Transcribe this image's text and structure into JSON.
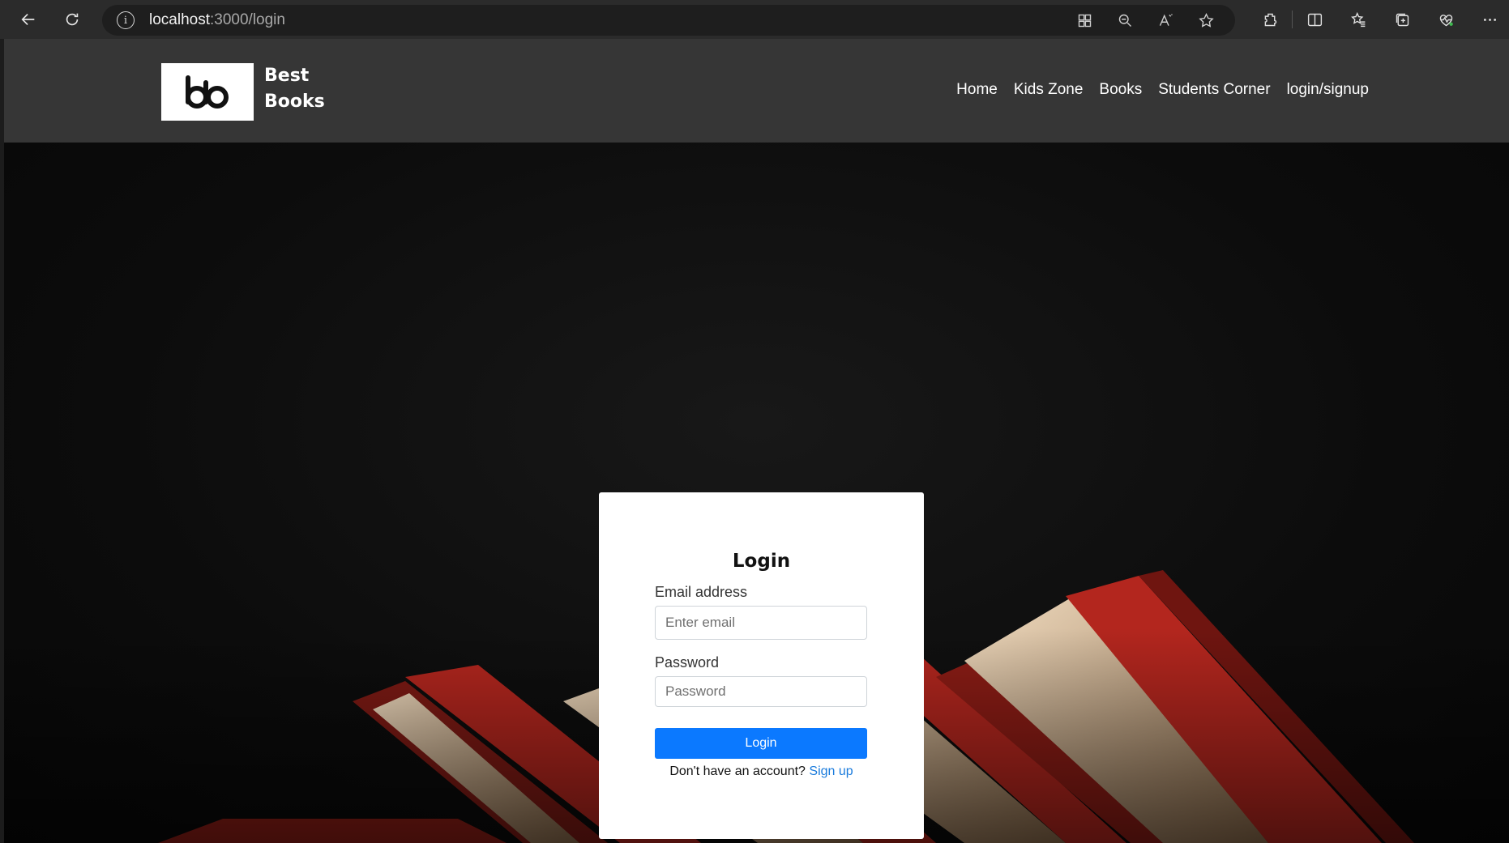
{
  "browser": {
    "url_host": "localhost",
    "url_path": ":3000/login",
    "info_glyph": "i",
    "icons": [
      "back-arrow-icon",
      "reload-icon",
      "info-icon",
      "app-grid-icon",
      "zoom-out-icon",
      "read-aloud-icon",
      "favorite-star-icon",
      "extensions-icon",
      "split-screen-icon",
      "favorites-list-icon",
      "collections-icon",
      "browser-essentials-icon",
      "more-menu-icon"
    ]
  },
  "header": {
    "brand_line1": "Best",
    "brand_line2": "Books",
    "nav": [
      "Home",
      "Kids Zone",
      "Books",
      "Students Corner",
      "login/signup"
    ]
  },
  "login": {
    "title": "Login",
    "email_label": "Email address",
    "email_placeholder": "Enter email",
    "password_label": "Password",
    "password_placeholder": "Password",
    "button_label": "Login",
    "signup_text": "Don't have an account?",
    "signup_link": "Sign up"
  },
  "colors": {
    "header_bg": "#363636",
    "primary_button": "#0b79ff",
    "link": "#1a7bdc",
    "book_red": "#b3261e"
  }
}
